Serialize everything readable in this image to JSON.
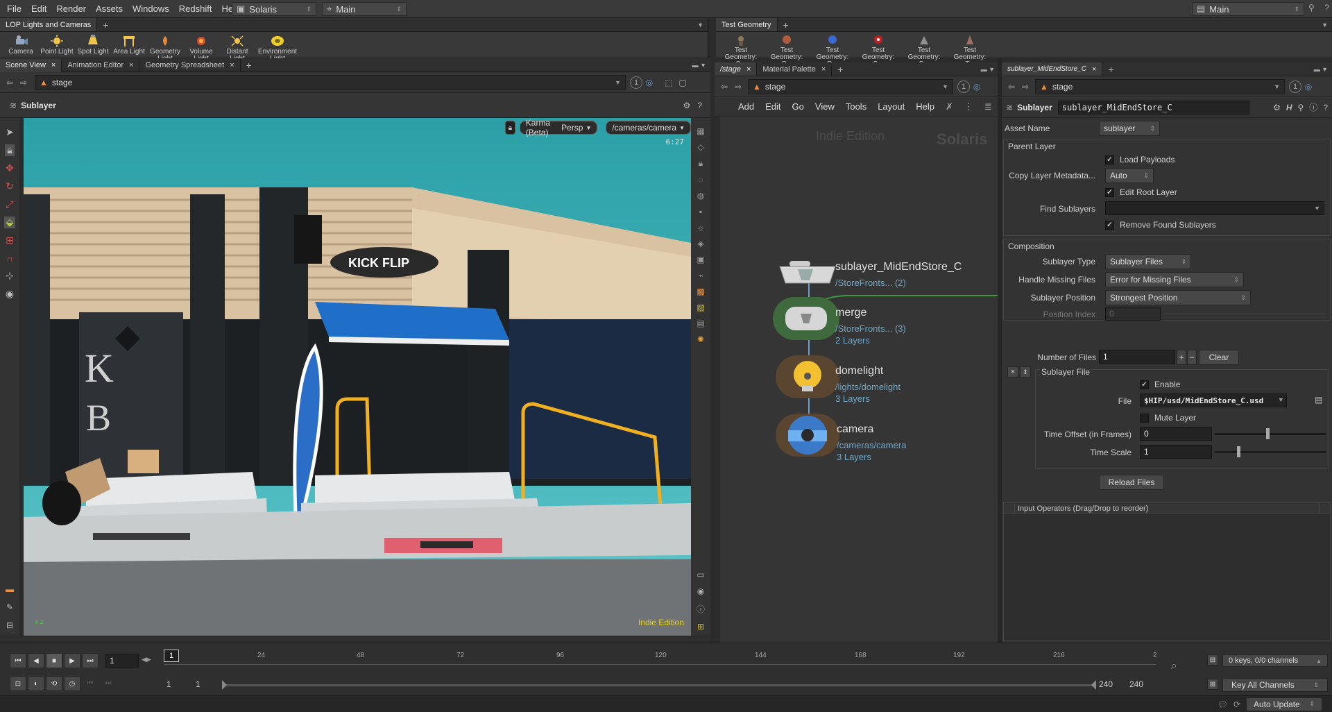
{
  "menubar": {
    "items": [
      "File",
      "Edit",
      "Render",
      "Assets",
      "Windows",
      "Redshift",
      "Help"
    ],
    "desktop": "Solaris",
    "viewset": "Main",
    "right_desktop": "Main"
  },
  "shelf_left": {
    "tab": "LOP Lights and Cameras",
    "tools": [
      {
        "label": "Camera",
        "icon": "camera-icon"
      },
      {
        "label": "Point Light",
        "icon": "point-light-icon"
      },
      {
        "label": "Spot Light",
        "icon": "spot-light-icon"
      },
      {
        "label": "Area Light",
        "icon": "area-light-icon"
      },
      {
        "label": "Geometry Light",
        "icon": "geometry-light-icon"
      },
      {
        "label": "Volume Light",
        "icon": "volume-light-icon"
      },
      {
        "label": "Distant Light",
        "icon": "distant-light-icon"
      },
      {
        "label": "Environment Light",
        "icon": "environment-light-icon"
      }
    ]
  },
  "shelf_right": {
    "tab": "Test Geometry",
    "tools": [
      {
        "label": "Test Geometry: C...",
        "icon": "test-geometry-icon",
        "color": "#8a7a5a"
      },
      {
        "label": "Test Geometry: P...",
        "icon": "test-geometry-icon",
        "color": "#b05a40"
      },
      {
        "label": "Test Geometry: R...",
        "icon": "test-geometry-icon",
        "color": "#3a6ad0"
      },
      {
        "label": "Test Geometry: S...",
        "icon": "test-geometry-icon",
        "color": "#c02020"
      },
      {
        "label": "Test Geometry: S...",
        "icon": "test-geometry-icon",
        "color": "#909090"
      },
      {
        "label": "Test Geometry: T...",
        "icon": "test-geometry-icon",
        "color": "#a07060"
      }
    ]
  },
  "left_pane": {
    "tabs": [
      "Scene View",
      "Animation Editor",
      "Geometry Spreadsheet"
    ],
    "path": "stage",
    "viewer_title": "Sublayer",
    "renderer": "Karma (Beta)",
    "view": "Persp",
    "camera": "/cameras/camera",
    "time": "6:27",
    "watermark": "Indie Edition",
    "axis": "x z"
  },
  "network": {
    "tabs": [
      "/stage",
      "Material Palette"
    ],
    "path": "stage",
    "menu": [
      "Add",
      "Edit",
      "Go",
      "View",
      "Tools",
      "Layout",
      "Help"
    ],
    "watermark_left": "Indie Edition",
    "watermark_right": "Solaris",
    "nodes": [
      {
        "name": "sublayer_MidEndStore_C",
        "sub": "/StoreFronts... (2)",
        "sub2": ""
      },
      {
        "name": "merge",
        "sub": "/StoreFronts... (3)",
        "sub2": "2 Layers"
      },
      {
        "name": "domelight",
        "sub": "/lights/domelight",
        "sub2": "3 Layers"
      },
      {
        "name": "camera",
        "sub": "/cameras/camera",
        "sub2": "3 Layers"
      }
    ],
    "badge": "1"
  },
  "params": {
    "tab": "sublayer_MidEndStore_C",
    "path": "stage",
    "node_type": "Sublayer",
    "node_name": "sublayer_MidEndStore_C",
    "badge": "1",
    "asset_name_label": "Asset Name",
    "asset_name": "sublayer",
    "parent_layer": {
      "title": "Parent Layer",
      "load_payloads": "Load Payloads",
      "copy_meta_label": "Copy Layer Metadata...",
      "copy_meta": "Auto",
      "edit_root": "Edit Root Layer",
      "find_label": "Find Sublayers",
      "find_value": "",
      "remove_found": "Remove Found Sublayers"
    },
    "composition": {
      "title": "Composition",
      "type_label": "Sublayer Type",
      "type": "Sublayer Files",
      "missing_label": "Handle Missing Files",
      "missing": "Error for Missing Files",
      "pos_label": "Sublayer Position",
      "pos": "Strongest Position",
      "index_label": "Position Index",
      "index": "0"
    },
    "files": {
      "count_label": "Number of Files",
      "count": "1",
      "clear": "Clear",
      "group": "Sublayer File",
      "enable": "Enable",
      "file_label": "File",
      "file": "$HIP/usd/MidEndStore_C.usd",
      "mute": "Mute Layer",
      "offset_label": "Time Offset (in Frames)",
      "offset": "0",
      "offset_level": 0.46,
      "scale_label": "Time Scale",
      "scale": "1",
      "scale_level": 0.2,
      "reload": "Reload Files"
    },
    "input_ops": "Input Operators (Drag/Drop to reorder)"
  },
  "timeline": {
    "frame": "1",
    "current": "1",
    "ticks": [
      "24",
      "48",
      "72",
      "96",
      "120",
      "144",
      "168",
      "192",
      "216",
      "2"
    ],
    "range_start": "1",
    "range_start2": "1",
    "range_end": "240",
    "range_end2": "240",
    "keys": "0 keys, 0/0 channels",
    "key_all": "Key All Channels",
    "auto_update": "Auto Update"
  }
}
